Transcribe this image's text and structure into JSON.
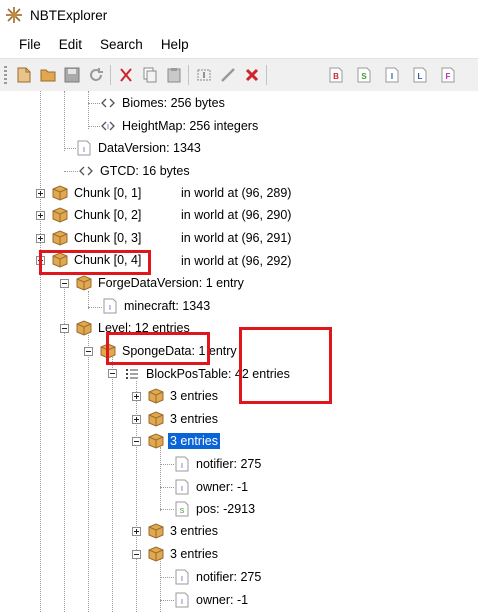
{
  "window": {
    "title": "NBTExplorer"
  },
  "menu": [
    "File",
    "Edit",
    "Search",
    "Help"
  ],
  "toolbar_icons": [
    "open-file-icon",
    "open-folder-icon",
    "save-icon",
    "refresh-icon",
    "cut-icon",
    "copy-icon",
    "paste-icon",
    "rename-icon",
    "edit-icon",
    "delete-icon",
    "add-byte-icon",
    "add-short-icon",
    "add-int-icon",
    "add-long-icon",
    "add-float-icon"
  ],
  "toolbar_letters": {
    "byte": "B",
    "short": "S",
    "int": "I",
    "long": "L",
    "float": "F"
  },
  "tree": {
    "biomes": "Biomes: 256 bytes",
    "heightmap": "HeightMap: 256 integers",
    "dataversion": "DataVersion: 1343",
    "gtcd": "GTCD: 16 bytes",
    "chunk01": "Chunk [0, 1]",
    "chunk01_world": "in world at (96, 289)",
    "chunk02": "Chunk [0, 2]",
    "chunk02_world": "in world at (96, 290)",
    "chunk03": "Chunk [0, 3]",
    "chunk03_world": "in world at (96, 291)",
    "chunk04": "Chunk [0, 4]",
    "chunk04_world": "in world at (96, 292)",
    "forgedataversion": "ForgeDataVersion: 1 entry",
    "minecraft": "minecraft: 1343",
    "level": "Level: 12 entries",
    "spongedata": "SpongeData: 1 entry",
    "blockpostable": "BlockPosTable: 42 entries",
    "entries1": "3 entries",
    "entries2": "3 entries",
    "entries3": "3 entries",
    "notifier1": "notifier: 275",
    "owner1": "owner: -1",
    "pos1": "pos: -2913",
    "entries4": "3 entries",
    "entries5": "3 entries",
    "notifier2": "notifier: 275",
    "owner2": "owner: -1"
  },
  "colors": {
    "selection": "#0a64d8",
    "highlight_box": "#e0161c",
    "folder": "#d79a4a"
  }
}
